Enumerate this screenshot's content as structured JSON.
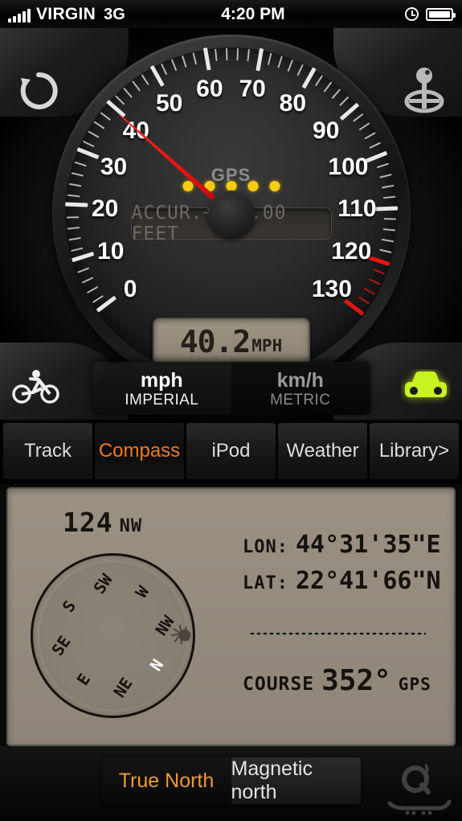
{
  "statusbar": {
    "carrier": "VIRGIN",
    "network": "3G",
    "time": "4:20 PM",
    "signal_icon": "signal-bars-icon",
    "clock_icon": "clock-icon",
    "battery_icon": "battery-icon"
  },
  "speedometer": {
    "reset_icon": "reset-arrow-icon",
    "gearshift_icon": "gear-shift-icon",
    "bike_icon": "bicycle-icon",
    "car_icon": "car-icon",
    "gps_label": "GPS",
    "gps_signal_dots": 5,
    "accuracy_text": "ACCUR.+/-5.00 FEET",
    "speed_value": "40.2",
    "speed_unit": "MPH",
    "needle_value": 40.2,
    "dial_min": 0,
    "dial_max": 130,
    "dial_labels": [
      "0",
      "10",
      "20",
      "30",
      "40",
      "50",
      "60",
      "70",
      "80",
      "90",
      "100",
      "110",
      "120",
      "130"
    ],
    "redline_start": 120,
    "units": [
      {
        "name": "imperial",
        "big": "mph",
        "small": "IMPERIAL",
        "selected": true
      },
      {
        "name": "metric",
        "big": "km/h",
        "small": "METRIC",
        "selected": false
      }
    ]
  },
  "tabs": [
    {
      "label": "Track",
      "active": false
    },
    {
      "label": "Compass",
      "active": true
    },
    {
      "label": "iPod",
      "active": false
    },
    {
      "label": "Weather",
      "active": false
    },
    {
      "label": "Library>",
      "active": false
    }
  ],
  "compass": {
    "heading_degrees": "124",
    "heading_direction": "NW",
    "rose_rotation_deg": 124,
    "rose_points": [
      "N",
      "NE",
      "E",
      "SE",
      "S",
      "SW",
      "W",
      "NW"
    ],
    "lon_label": "LON:",
    "lon_value": "44°31'35\"E",
    "lat_label": "LAT:",
    "lat_value": "22°41'66\"N",
    "course_label": "COURSE",
    "course_value": "352°",
    "course_source": "GPS"
  },
  "bottom": {
    "north_modes": [
      {
        "label": "True North",
        "selected": true
      },
      {
        "label": "Magnetic north",
        "selected": false
      }
    ],
    "watermark_icon": "sabegh-logo-watermark"
  },
  "colors": {
    "accent_orange": "#ef7a20",
    "needle_red": "#e81010",
    "redline": "#e81414",
    "gps_dot": "#f5cc10",
    "car_green": "#c8f220",
    "lcd_tan": "#9d9484",
    "panel_tan": "#9a9183"
  }
}
